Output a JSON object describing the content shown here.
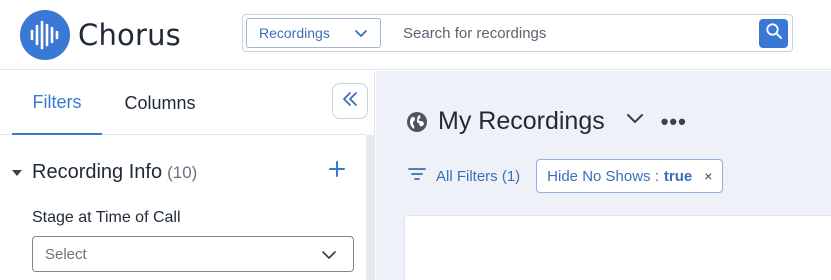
{
  "header": {
    "app_name": "Chorus",
    "search": {
      "scope_label": "Recordings",
      "placeholder": "Search for recordings",
      "value": ""
    }
  },
  "left_panel": {
    "tabs": [
      {
        "label": "Filters",
        "active": true
      },
      {
        "label": "Columns",
        "active": false
      }
    ],
    "section": {
      "title": "Recording Info",
      "count": "(10)"
    },
    "field": {
      "label": "Stage at Time of Call",
      "select_value": "Select"
    }
  },
  "main": {
    "title": "My Recordings",
    "more_label": "•••",
    "all_filters_label": "All Filters (1)",
    "chip": {
      "label": "Hide No Shows :",
      "value": "true",
      "close": "×"
    }
  },
  "colors": {
    "accent": "#3a78d6",
    "main_bg": "#eef2f8"
  }
}
